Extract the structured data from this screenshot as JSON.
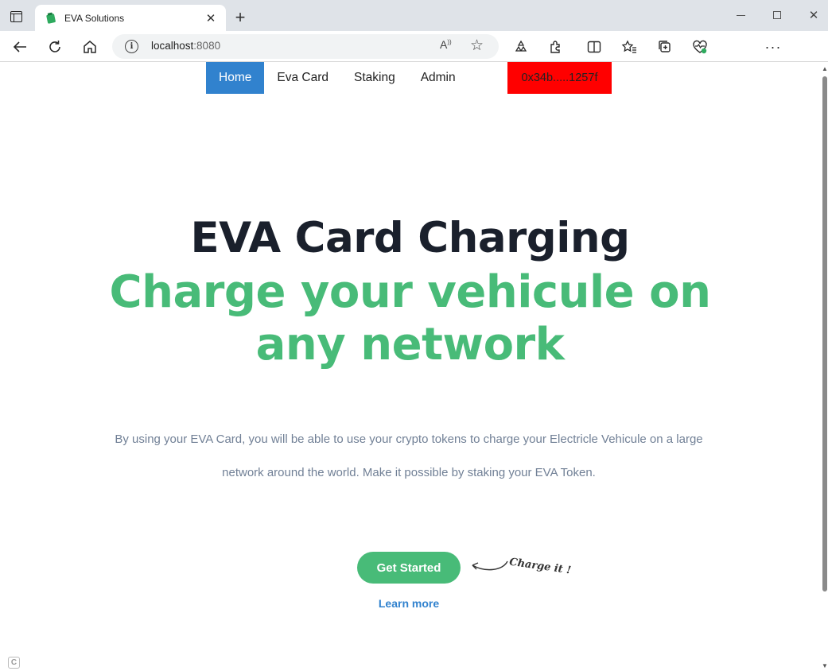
{
  "browser": {
    "tab_title": "EVA Solutions",
    "tab_close_glyph": "✕",
    "new_tab_glyph": "+",
    "url_host": "localhost",
    "url_port": ":8080",
    "icons": [
      "tab-actions-icon",
      "favicon-icon",
      "back-icon",
      "refresh-icon",
      "home-icon",
      "info-icon",
      "read-aloud-icon",
      "favorite-star-icon",
      "recycle-icon",
      "extensions-icon",
      "split-screen-icon",
      "favorites-icon",
      "collections-icon",
      "browser-essentials-icon",
      "profile-icon",
      "more-icon",
      "bing-icon"
    ],
    "window_controls": {
      "close_glyph": "✕"
    }
  },
  "nav": {
    "items": [
      {
        "label": "Home",
        "active": true
      },
      {
        "label": "Eva Card",
        "active": false
      },
      {
        "label": "Staking",
        "active": false
      },
      {
        "label": "Admin",
        "active": false
      }
    ],
    "wallet_address": "0x34b.....1257f",
    "wallet_color": "#ff0000",
    "active_color": "#3182ce"
  },
  "hero": {
    "title": "EVA Card Charging",
    "subtitle_line1": "Charge your vehicule on",
    "subtitle_line2": "any network",
    "subtitle_color": "#48bb78",
    "description": "By using your EVA Card, you will be able to use your crypto tokens to charge your Electricle Vehicule on a large network around the world. Make it possible by staking your EVA Token.",
    "cta_label": "Get Started",
    "cta_note": "Charge it !",
    "learn_more": "Learn more"
  },
  "corner_badge": "C"
}
